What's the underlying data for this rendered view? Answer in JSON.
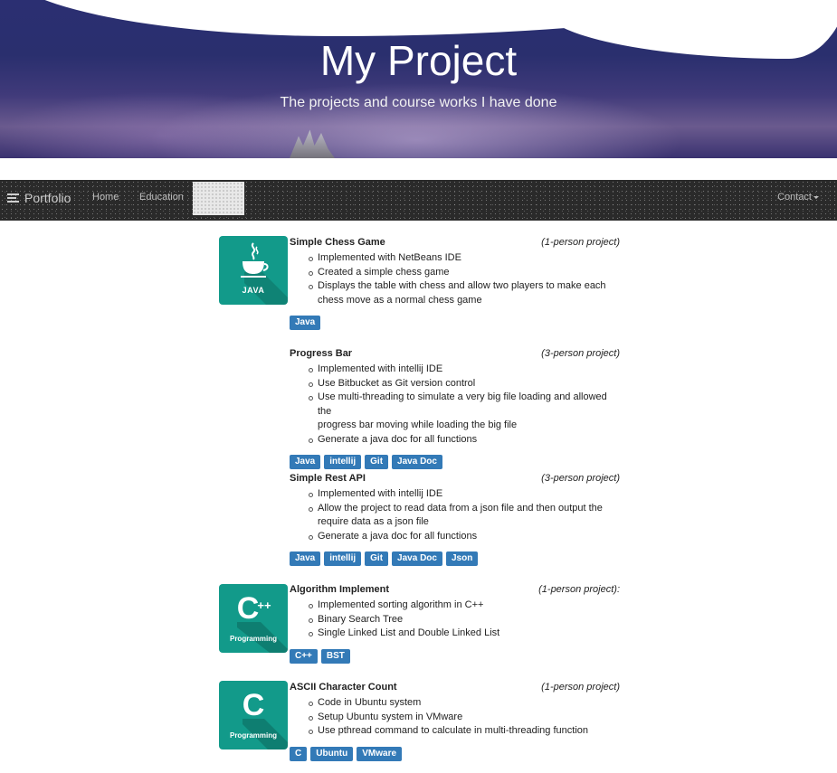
{
  "hero": {
    "title": "My Project",
    "subtitle": "The projects and course works I have done"
  },
  "navbar": {
    "brand": "Portfolio",
    "brand_icon": "menu-lines-icon",
    "items": [
      {
        "label": "Home"
      },
      {
        "label": "Education"
      }
    ],
    "contact": "Contact",
    "contact_icon": "caret-down-icon"
  },
  "logos": {
    "java": {
      "label": "JAVA",
      "icon": "java-cup-icon"
    },
    "cpp": {
      "letter": "C",
      "sup": "++",
      "label": "Programming"
    },
    "c": {
      "letter": "C",
      "label": "Programming"
    },
    "color": "#129a8a"
  },
  "tag_color": "#337ab7",
  "projects": [
    {
      "title": "Simple Chess Game",
      "size": "(1-person project)",
      "bullets": [
        "Implemented with NetBeans IDE",
        "Created a simple chess game",
        "Displays the table with chess and allow two players to make each",
        "chess move as a normal chess game"
      ],
      "tags": [
        "Java"
      ]
    },
    {
      "title": "Progress Bar",
      "size": "(3-person project)",
      "bullets": [
        "Implemented with intellij IDE",
        "Use Bitbucket as Git version control",
        "Use multi-threading to simulate a very big file loading and allowed the",
        "progress bar moving while loading the big file",
        "Generate a java doc for all functions"
      ],
      "tags": [
        "Java",
        "intellij",
        "Git",
        "Java Doc"
      ]
    },
    {
      "title": "Simple Rest API",
      "size": "(3-person project)",
      "bullets": [
        "Implemented with intellij IDE",
        "Allow the project to read data from a json file and then output the",
        "require data as a json file",
        "Generate a java doc for all functions"
      ],
      "tags": [
        "Java",
        "intellij",
        "Git",
        "Java Doc",
        "Json"
      ]
    },
    {
      "title": "Algorithm Implement",
      "size": "(1-person project):",
      "bullets": [
        "Implemented sorting algorithm in C++",
        "Binary Search Tree",
        "Single Linked List and Double Linked List"
      ],
      "tags": [
        "C++",
        "BST"
      ]
    },
    {
      "title": "ASCII Character Count",
      "size": "(1-person project)",
      "bullets": [
        "Code in Ubuntu system",
        "Setup Ubuntu system in VMware",
        "Use pthread command to calculate in multi-threading function"
      ],
      "tags": [
        "C",
        "Ubuntu",
        "VMware"
      ]
    }
  ]
}
